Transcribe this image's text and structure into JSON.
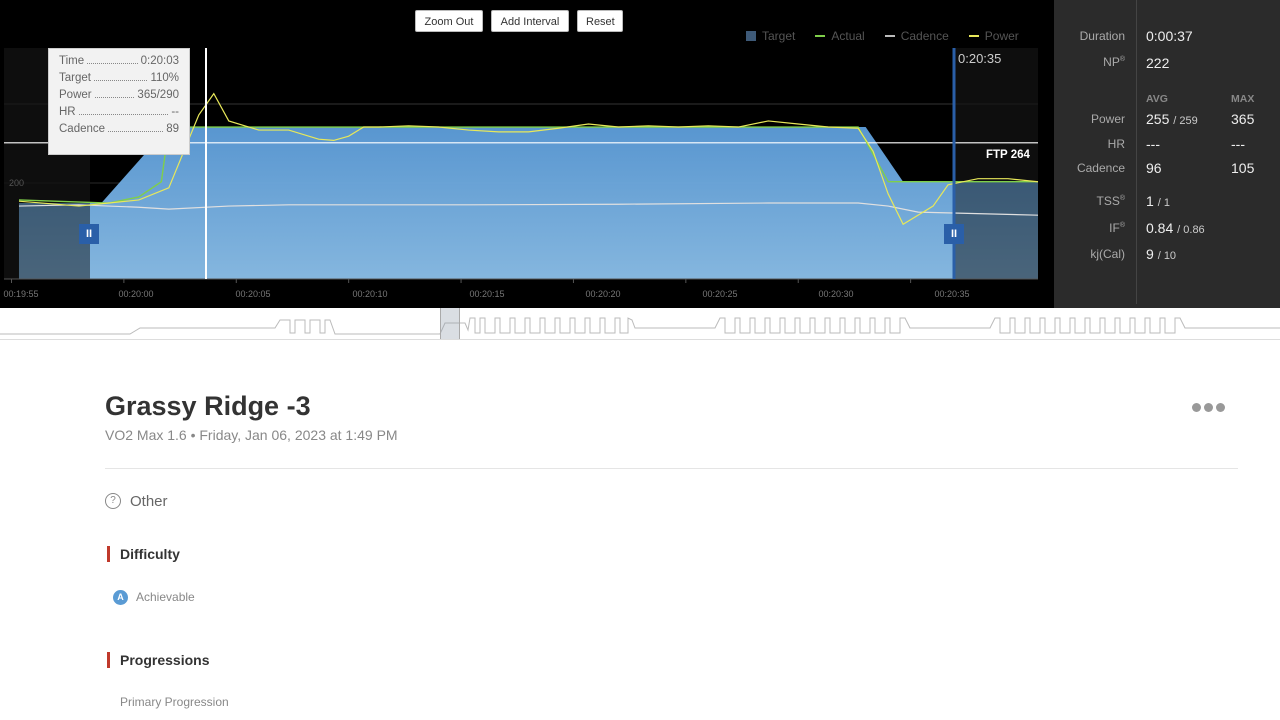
{
  "toolbar": {
    "zoom_out": "Zoom Out",
    "add_interval": "Add Interval",
    "reset": "Reset"
  },
  "legend": [
    {
      "label": "Target",
      "color": "#3e5a78"
    },
    {
      "label": "Actual",
      "color": "#7fcf4a"
    },
    {
      "label": "Cadence",
      "color": "#bbbbbb"
    },
    {
      "label": "Power",
      "color": "#e8e85a"
    }
  ],
  "tooltip": {
    "time_label": "Time",
    "time": "0:20:03",
    "target_label": "Target",
    "target": "110%",
    "power_label": "Power",
    "power": "365/290",
    "hr_label": "HR",
    "hr": "--",
    "cadence_label": "Cadence",
    "cadence": "89"
  },
  "chart": {
    "end_time": "0:20:35",
    "ftp_label": "FTP 264",
    "y_tick": "200"
  },
  "chart_data": {
    "type": "line",
    "ftp": 264,
    "x_ticks": [
      "00:19:55",
      "00:20:00",
      "00:20:05",
      "00:20:10",
      "00:20:15",
      "00:20:20",
      "00:20:25",
      "00:20:30",
      "00:20:35"
    ],
    "series": [
      {
        "name": "Target",
        "values": [
          [
            0,
            165
          ],
          [
            5.5,
            165
          ],
          [
            10,
            290
          ],
          [
            56.5,
            290
          ],
          [
            59,
            200
          ],
          [
            68,
            200
          ]
        ]
      },
      {
        "name": "Actual",
        "values": [
          [
            0,
            170
          ],
          [
            6,
            165
          ],
          [
            8,
            175
          ],
          [
            9.5,
            200
          ],
          [
            10,
            290
          ],
          [
            56,
            290
          ],
          [
            58,
            200
          ],
          [
            68,
            200
          ]
        ]
      },
      {
        "name": "Power",
        "values": [
          [
            0,
            168
          ],
          [
            4,
            160
          ],
          [
            6,
            165
          ],
          [
            8,
            170
          ],
          [
            10,
            190
          ],
          [
            12,
            310
          ],
          [
            13,
            345
          ],
          [
            14,
            300
          ],
          [
            16,
            285
          ],
          [
            18,
            285
          ],
          [
            20,
            270
          ],
          [
            21,
            268
          ],
          [
            22,
            275
          ],
          [
            23,
            290
          ],
          [
            24,
            290
          ],
          [
            26,
            292
          ],
          [
            28,
            290
          ],
          [
            30,
            285
          ],
          [
            32,
            282
          ],
          [
            34,
            282
          ],
          [
            36,
            288
          ],
          [
            38,
            295
          ],
          [
            40,
            290
          ],
          [
            42,
            292
          ],
          [
            44,
            290
          ],
          [
            46,
            292
          ],
          [
            48,
            290
          ],
          [
            50,
            300
          ],
          [
            52,
            295
          ],
          [
            54,
            290
          ],
          [
            56,
            288
          ],
          [
            57,
            250
          ],
          [
            58,
            180
          ],
          [
            59,
            130
          ],
          [
            61,
            160
          ],
          [
            62,
            195
          ],
          [
            64,
            205
          ],
          [
            66,
            205
          ],
          [
            68,
            200
          ]
        ]
      },
      {
        "name": "Cadence",
        "values": [
          [
            0,
            160
          ],
          [
            4,
            162
          ],
          [
            6,
            160
          ],
          [
            8,
            158
          ],
          [
            10,
            155
          ],
          [
            14,
            160
          ],
          [
            18,
            162
          ],
          [
            30,
            162
          ],
          [
            40,
            163
          ],
          [
            50,
            165
          ],
          [
            56,
            165
          ],
          [
            58,
            160
          ],
          [
            60,
            150
          ],
          [
            68,
            145
          ]
        ]
      }
    ]
  },
  "stats": {
    "duration_label": "Duration",
    "duration": "0:00:37",
    "np_label": "NP",
    "np": "222",
    "avg_head": "AVG",
    "max_head": "MAX",
    "power_label": "Power",
    "power_avg": "255",
    "power_avg2": "259",
    "power_max": "365",
    "hr_label": "HR",
    "hr_avg": "---",
    "hr_max": "---",
    "cadence_label": "Cadence",
    "cadence_avg": "96",
    "cadence_max": "105",
    "tss_label": "TSS",
    "tss": "1",
    "tss2": "1",
    "if_label": "IF",
    "if": "0.84",
    "if2": "0.86",
    "kj_label": "kj(Cal)",
    "kj": "9",
    "kj2": "10"
  },
  "workout": {
    "title": "Grassy Ridge -3",
    "subtitle": "VO2 Max 1.6 • Friday, Jan 06, 2023 at 1:49 PM",
    "category": "Other",
    "difficulty_title": "Difficulty",
    "difficulty_badge": "A",
    "difficulty": "Achievable",
    "progressions_title": "Progressions",
    "primary_progression": "Primary Progression"
  }
}
